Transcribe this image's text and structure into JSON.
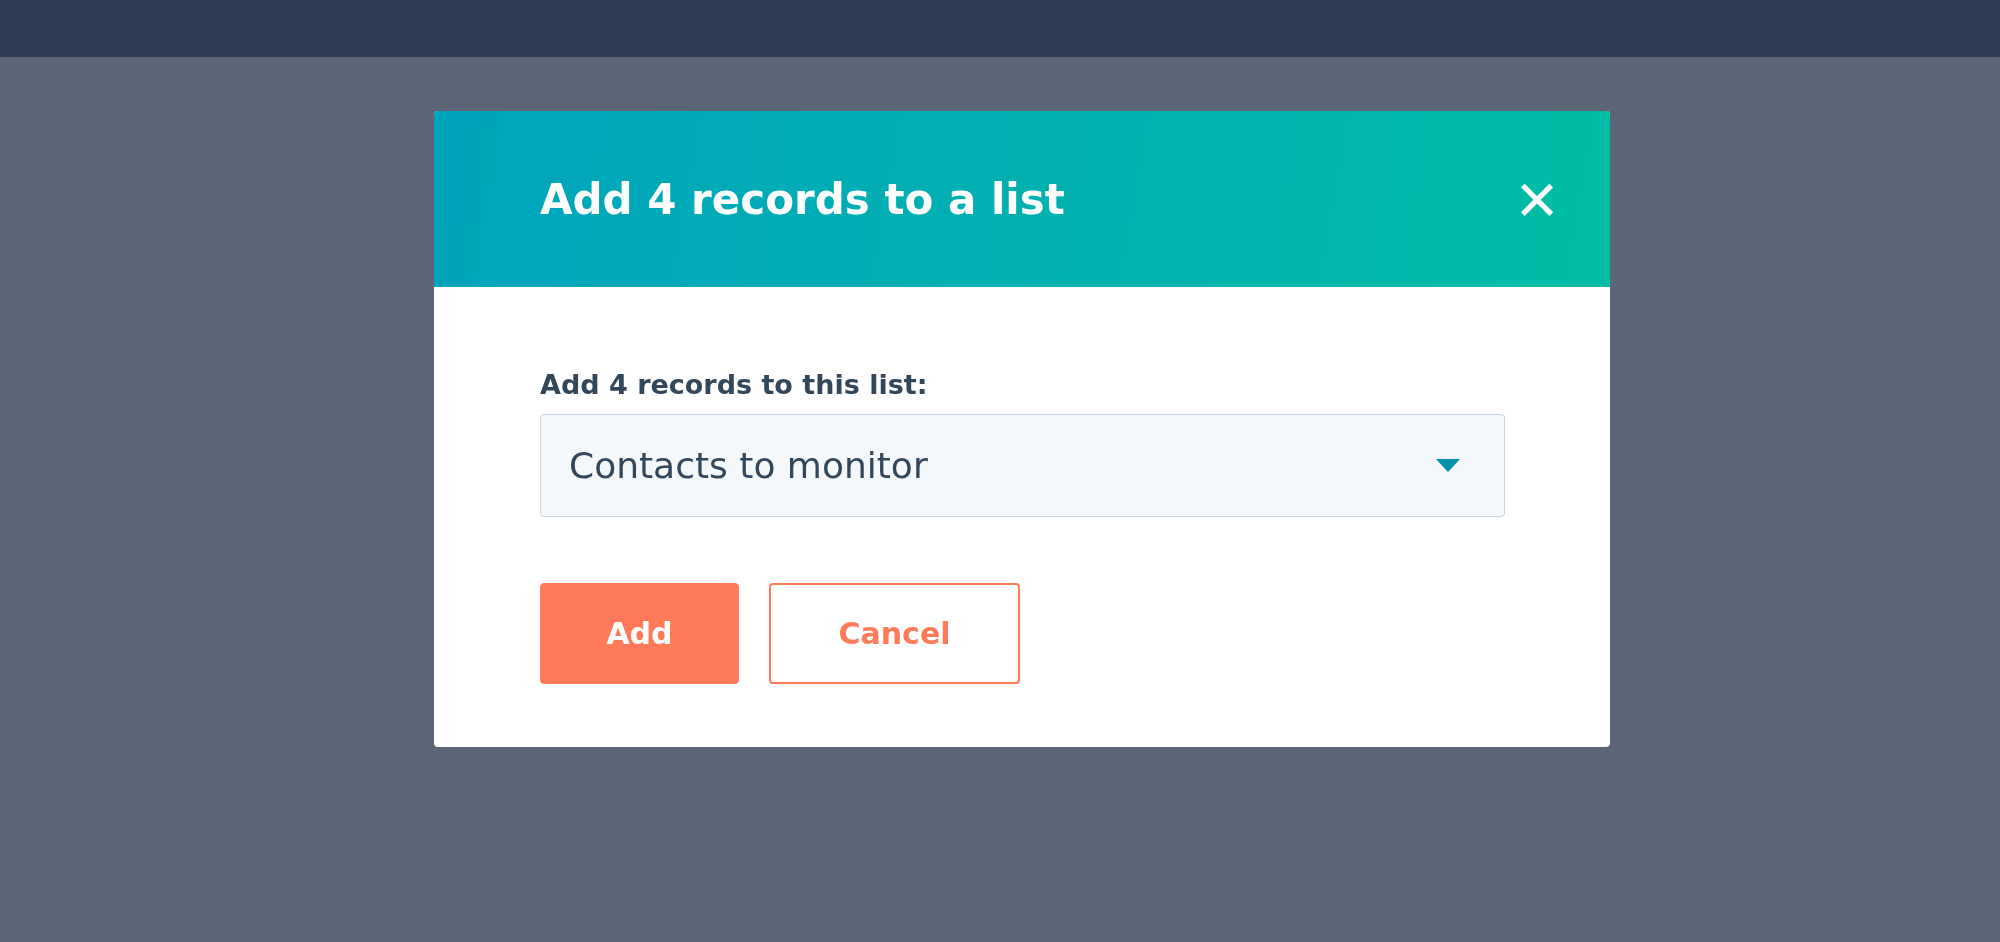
{
  "dialog": {
    "title": "Add 4 records to a list",
    "close": "×",
    "field": {
      "label": "Add 4 records to this list:",
      "value": "Contacts to monitor"
    },
    "buttons": [
      {
        "label": "Add",
        "kind": "primary"
      },
      {
        "label": "Cancel",
        "kind": "secondary"
      }
    ]
  }
}
